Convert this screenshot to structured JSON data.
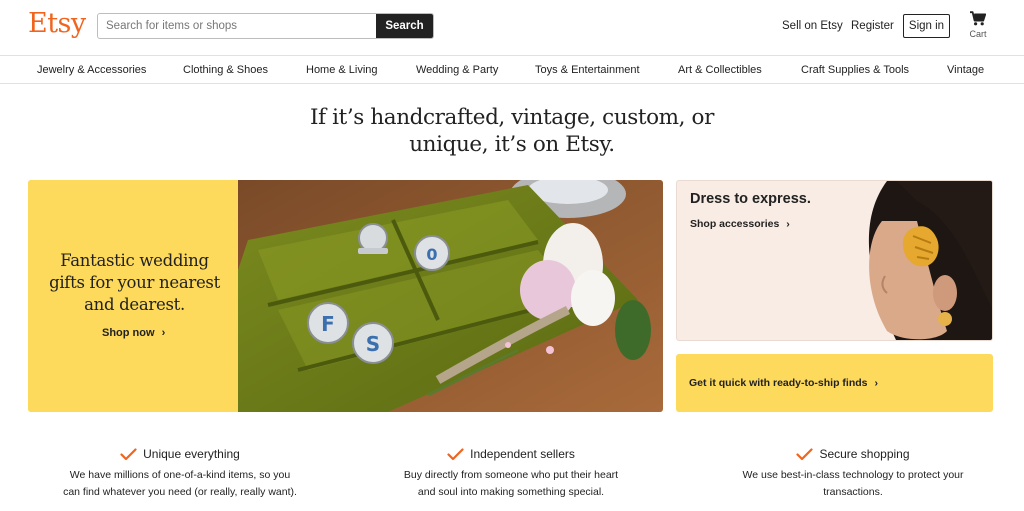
{
  "header": {
    "logo": "Etsy",
    "search": {
      "placeholder": "Search for items or shops",
      "button_label": "Search"
    },
    "sell_label": "Sell on Etsy",
    "register_label": "Register",
    "signin_label": "Sign in",
    "cart_label": "Cart"
  },
  "nav": {
    "categories": [
      "Jewelry & Accessories",
      "Clothing & Shoes",
      "Home & Living",
      "Wedding & Party",
      "Toys & Entertainment",
      "Art & Collectibles",
      "Craft Supplies & Tools",
      "Vintage"
    ]
  },
  "hero": {
    "line1": "If it’s handcrafted, vintage, custom, or",
    "line2": "unique, it’s on Etsy."
  },
  "banner": {
    "heading": "Fantastic wedding gifts for your nearest and dearest.",
    "shop_label": "Shop now",
    "image_icon": "cufflinks-photo"
  },
  "dress_card": {
    "title": "Dress to express.",
    "shop_label": "Shop accessories",
    "image_icon": "woman-hair-clip-photo"
  },
  "ship_card": {
    "label": "Get it quick with ready-to-ship finds"
  },
  "features": [
    {
      "title": "Unique everything",
      "desc1": "We have millions of one-of-a-kind items, so you",
      "desc2": "can find whatever you need (or really, really want)."
    },
    {
      "title": "Independent sellers",
      "desc1": "Buy directly from someone who put their heart",
      "desc2": "and soul into making something special."
    },
    {
      "title": "Secure shopping",
      "desc1": "We use best-in-class technology to protect your",
      "desc2": "transactions."
    }
  ],
  "colors": {
    "brand": "#f1641e",
    "yellow": "#fdd95c",
    "dark": "#222222"
  }
}
